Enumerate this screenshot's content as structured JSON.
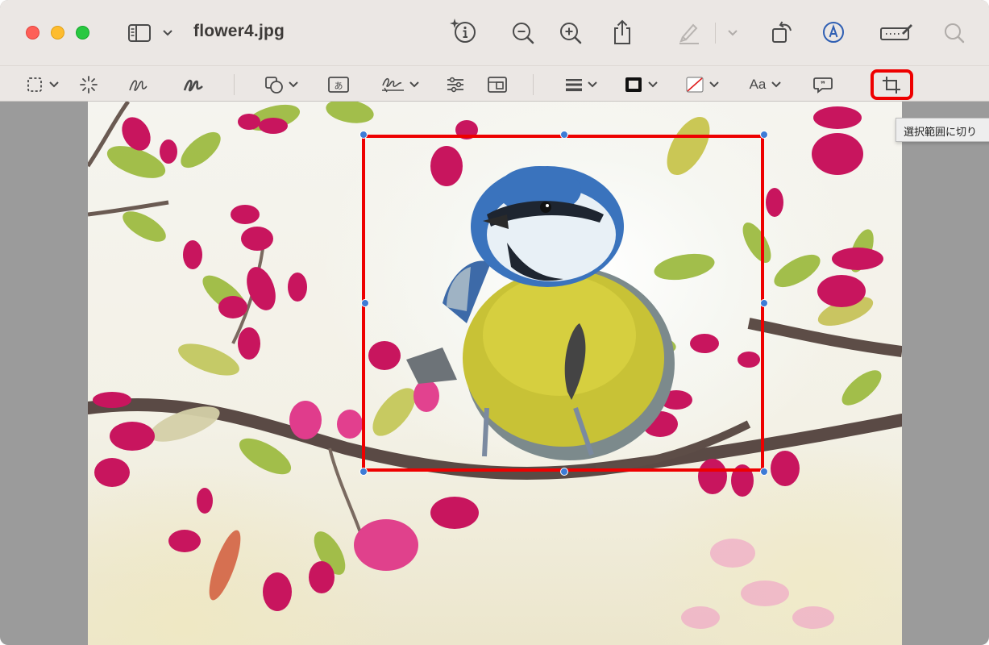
{
  "window": {
    "title": "flower4.jpg"
  },
  "titlebar": {
    "traffic_lights": [
      "close",
      "minimize",
      "zoom"
    ],
    "icons": [
      "sidebar-icon",
      "chevron-down-icon",
      "info-sparkle-icon",
      "zoom-out-icon",
      "zoom-in-icon",
      "share-icon",
      "highlight-pen-icon",
      "chevron-down-icon",
      "rotate-icon",
      "markup-icon",
      "signature-icon",
      "search-icon"
    ]
  },
  "markup_toolbar": {
    "tools": [
      "rect-select-tool",
      "instant-alpha-tool",
      "sketch-tool",
      "draw-tool",
      "shapes-tool",
      "text-tool",
      "sign-tool",
      "adjust-color-tool",
      "adjust-size-tool",
      "line-style-tool",
      "border-color-tool",
      "fill-color-tool",
      "text-style-tool",
      "note-tool",
      "crop-tool"
    ],
    "text_style_label": "Aa"
  },
  "tooltip": {
    "text": "選択範囲に切り"
  },
  "colors": {
    "selection": "#ee0000",
    "handles": "#3d7bd6",
    "toolbar_bg": "#ebe7e4"
  }
}
